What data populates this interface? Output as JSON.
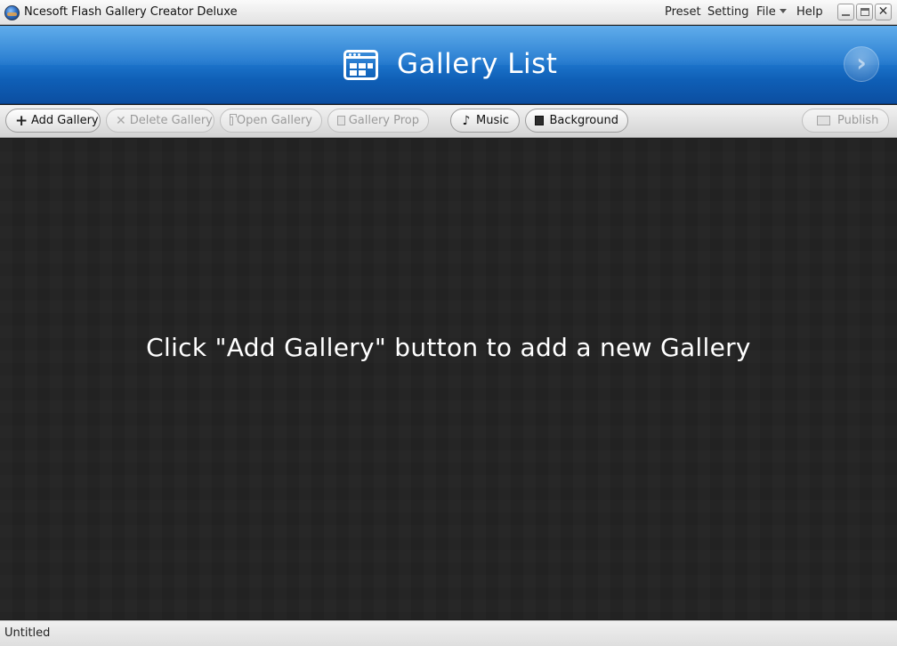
{
  "window": {
    "title": "Ncesoft Flash Gallery Creator Deluxe",
    "menu": {
      "preset": "Preset",
      "setting": "Setting",
      "file": "File",
      "help": "Help"
    },
    "controls": {
      "minimize": "minimize-icon",
      "maximize": "maximize-icon",
      "close": "close-icon"
    }
  },
  "header": {
    "title": "Gallery List",
    "icon": "gallery-list-icon",
    "next_icon": "chevron-right-icon"
  },
  "toolbar": {
    "add_gallery": "Add Gallery",
    "delete_gallery": "Delete Gallery",
    "open_gallery": "Open Gallery",
    "gallery_prop": "Gallery Prop",
    "music": "Music",
    "background": "Background",
    "publish": "Publish"
  },
  "content": {
    "placeholder": "Click \"Add Gallery\" button to add a new Gallery"
  },
  "status": {
    "text": "Untitled"
  },
  "colors": {
    "header_blue": "#1f78cf",
    "content_bg": "#242424",
    "toolbar_bg": "#e6e6e6"
  }
}
